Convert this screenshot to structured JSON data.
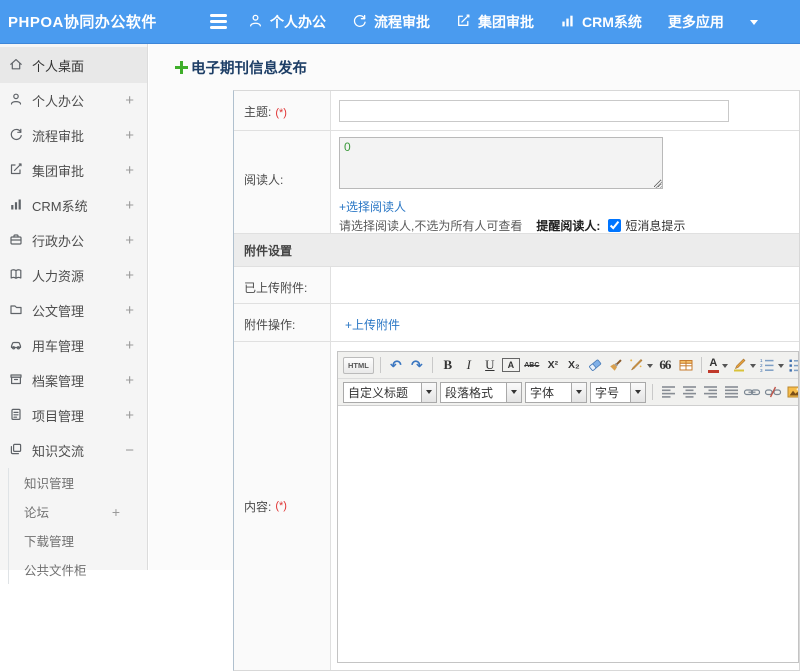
{
  "colors": {
    "header_blue": "#4a9bef",
    "link_blue": "#2a77c5",
    "title_navy": "#1d3e66",
    "required_red": "#e03333",
    "plus_green": "#3fae2a",
    "readers_value_green": "#3c9a3c",
    "sidebar_bg": "#f5f5f5",
    "section_header_bg": "#ececec"
  },
  "icons": {
    "menu-icon": "three-bars css-shape",
    "caret-down-icon": "▼",
    "user-icon": "svg person outline",
    "workflow-icon": "svg circular arrow",
    "edit-icon": "svg square with pencil",
    "bar-chart-icon": "svg bars",
    "home-icon": "svg house",
    "briefcase-icon": "svg briefcase",
    "book-icon": "svg open book",
    "folder-icon": "svg folder",
    "car-icon": "svg car",
    "archive-icon": "svg archive box",
    "clipboard-icon": "svg clipboard",
    "copy-icon": "svg overlapping squares",
    "plus-icon": "+",
    "minus-icon": "−"
  },
  "header": {
    "app_title": "PHPOA协同办公软件",
    "nav_items": [
      {
        "label": "个人办公",
        "icon": "user-icon"
      },
      {
        "label": "流程审批",
        "icon": "workflow-icon"
      },
      {
        "label": "集团审批",
        "icon": "edit-icon"
      },
      {
        "label": "CRM系统",
        "icon": "bar-chart-icon"
      },
      {
        "label": "更多应用",
        "icon": "caret-down-icon"
      }
    ]
  },
  "sidebar": {
    "items": [
      {
        "label": "个人桌面",
        "icon": "home-icon",
        "expand": "",
        "active": true
      },
      {
        "label": "个人办公",
        "icon": "user-icon",
        "expand": "+"
      },
      {
        "label": "流程审批",
        "icon": "workflow-icon",
        "expand": "+"
      },
      {
        "label": "集团审批",
        "icon": "edit-icon",
        "expand": "+"
      },
      {
        "label": "CRM系统",
        "icon": "bar-chart-icon",
        "expand": "+"
      },
      {
        "label": "行政办公",
        "icon": "briefcase-icon",
        "expand": "+"
      },
      {
        "label": "人力资源",
        "icon": "book-icon",
        "expand": "+"
      },
      {
        "label": "公文管理",
        "icon": "folder-icon",
        "expand": "+"
      },
      {
        "label": "用车管理",
        "icon": "car-icon",
        "expand": "+"
      },
      {
        "label": "档案管理",
        "icon": "archive-icon",
        "expand": "+"
      },
      {
        "label": "项目管理",
        "icon": "clipboard-icon",
        "expand": "+"
      },
      {
        "label": "知识交流",
        "icon": "copy-icon",
        "expand": "−",
        "expanded": true
      }
    ],
    "subitems": [
      {
        "label": "知识管理",
        "expand": ""
      },
      {
        "label": "论坛",
        "expand": "+"
      },
      {
        "label": "下载管理",
        "expand": ""
      },
      {
        "label": "公共文件柜",
        "expand": ""
      }
    ]
  },
  "main": {
    "page_title": "电子期刊信息发布",
    "form": {
      "subject_label": "主题:",
      "required_mark": "(*)",
      "subject_value": "",
      "readers_label": "阅读人:",
      "readers_value": "0",
      "choose_readers_link": "+选择阅读人",
      "readers_hint": "请选择阅读人,不选为所有人可查看",
      "remind_readers_label": "提醒阅读人:",
      "sms_notify_label": "短消息提示",
      "sms_checked": true,
      "attachments_section_title": "附件设置",
      "uploaded_attachments_label": "已上传附件:",
      "attachment_actions_label": "附件操作:",
      "upload_attachment_link": "+上传附件",
      "content_label": "内容:"
    },
    "editor": {
      "html_source_label": "HTML",
      "bold_label": "B",
      "italic_label": "I",
      "underline_label": "U",
      "font_box_label": "A",
      "strikethrough_label": "ABC",
      "superscript_label": "X²",
      "subscript_label": "X₂",
      "blockquote_label": "66",
      "font_color_label": "A",
      "heading_select": "自定义标题",
      "paragraph_select": "段落格式",
      "font_family_select": "字体",
      "font_size_select": "字号"
    }
  }
}
